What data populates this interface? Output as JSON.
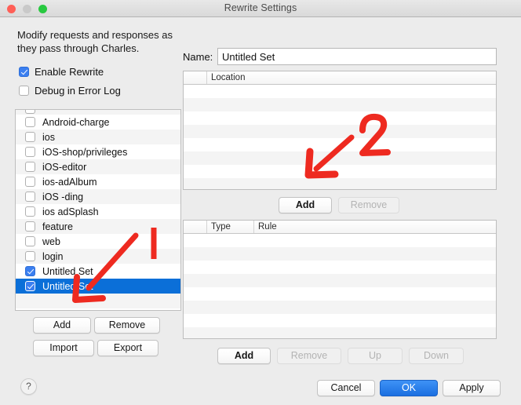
{
  "window": {
    "title": "Rewrite Settings",
    "traffic_lights": [
      "close",
      "minimize",
      "zoom"
    ]
  },
  "left_panel": {
    "intro_text": "Modify requests and responses as they pass through Charles.",
    "checkboxes": [
      {
        "label": "Enable Rewrite",
        "checked": true
      },
      {
        "label": "Debug in Error Log",
        "checked": false
      }
    ],
    "sets": [
      {
        "label": "Android-charge",
        "checked": false,
        "selected": false
      },
      {
        "label": "ios",
        "checked": false,
        "selected": false
      },
      {
        "label": "iOS-shop/privileges",
        "checked": false,
        "selected": false
      },
      {
        "label": "iOS-editor",
        "checked": false,
        "selected": false
      },
      {
        "label": "ios-adAlbum",
        "checked": false,
        "selected": false
      },
      {
        "label": "iOS -ding",
        "checked": false,
        "selected": false
      },
      {
        "label": "ios adSplash",
        "checked": false,
        "selected": false
      },
      {
        "label": "feature",
        "checked": false,
        "selected": false
      },
      {
        "label": "web",
        "checked": false,
        "selected": false
      },
      {
        "label": "login",
        "checked": false,
        "selected": false
      },
      {
        "label": "Untitled Set",
        "checked": true,
        "selected": false
      },
      {
        "label": "Untitled Set",
        "checked": true,
        "selected": true
      }
    ],
    "buttons": {
      "add": "Add",
      "remove": "Remove",
      "import": "Import",
      "export": "Export"
    },
    "help": "?"
  },
  "right_panel": {
    "name_label": "Name:",
    "name_value": "Untitled Set",
    "name_placeholder": "",
    "location_table": {
      "columns": [
        "",
        "Location"
      ],
      "rows": []
    },
    "location_buttons": {
      "add": "Add",
      "remove": "Remove",
      "remove_disabled": true
    },
    "rules_table": {
      "columns": [
        "",
        "Type",
        "Rule"
      ],
      "rows": []
    },
    "rules_buttons": {
      "add": "Add",
      "remove": "Remove",
      "up": "Up",
      "down": "Down",
      "remove_disabled": true,
      "up_disabled": true,
      "down_disabled": true
    }
  },
  "dialog_buttons": {
    "cancel": "Cancel",
    "ok": "OK",
    "apply": "Apply",
    "default_button": "OK"
  },
  "annotations": {
    "color": "#ee2a20",
    "marks": [
      {
        "label": "1",
        "kind": "arrow-and-digit",
        "points_to": "left-add-button"
      },
      {
        "label": "2",
        "kind": "arrow-and-digit",
        "points_to": "location-add-button"
      }
    ]
  },
  "colors": {
    "selection": "#0b6fd8",
    "checkbox_on": "#3b7ff0",
    "default_button": "#1b6fe0",
    "annotation_red": "#ee2a20",
    "window_chrome": "#ececec"
  }
}
